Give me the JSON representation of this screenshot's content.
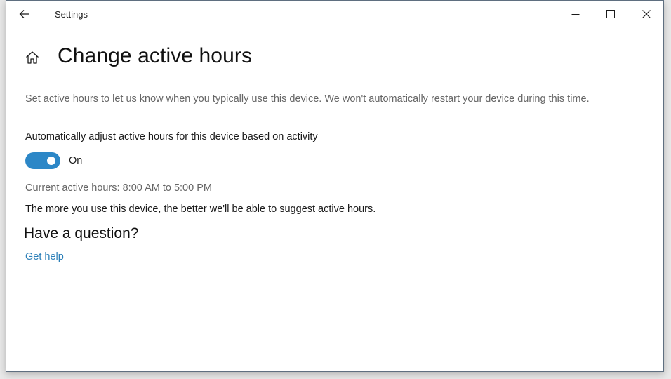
{
  "window": {
    "app_title": "Settings"
  },
  "page": {
    "title": "Change active hours",
    "description": "Set active hours to let us know when you typically use this device. We won't automatically restart your device during this time.",
    "toggle": {
      "label": "Automatically adjust active hours for this device based on activity",
      "state_text": "On",
      "on": true
    },
    "current_hours": "Current active hours: 8:00 AM to 5:00 PM",
    "info": "The more you use this device, the better we'll be able to suggest active hours."
  },
  "help": {
    "heading": "Have a question?",
    "link": "Get help"
  },
  "icons": {
    "back": "back-arrow-icon",
    "home": "home-icon",
    "minimize": "minimize-icon",
    "maximize": "maximize-icon",
    "close": "close-icon"
  },
  "colors": {
    "accent": "#2c87c7",
    "link": "#2b7fb8",
    "secondary_text": "#666666"
  }
}
